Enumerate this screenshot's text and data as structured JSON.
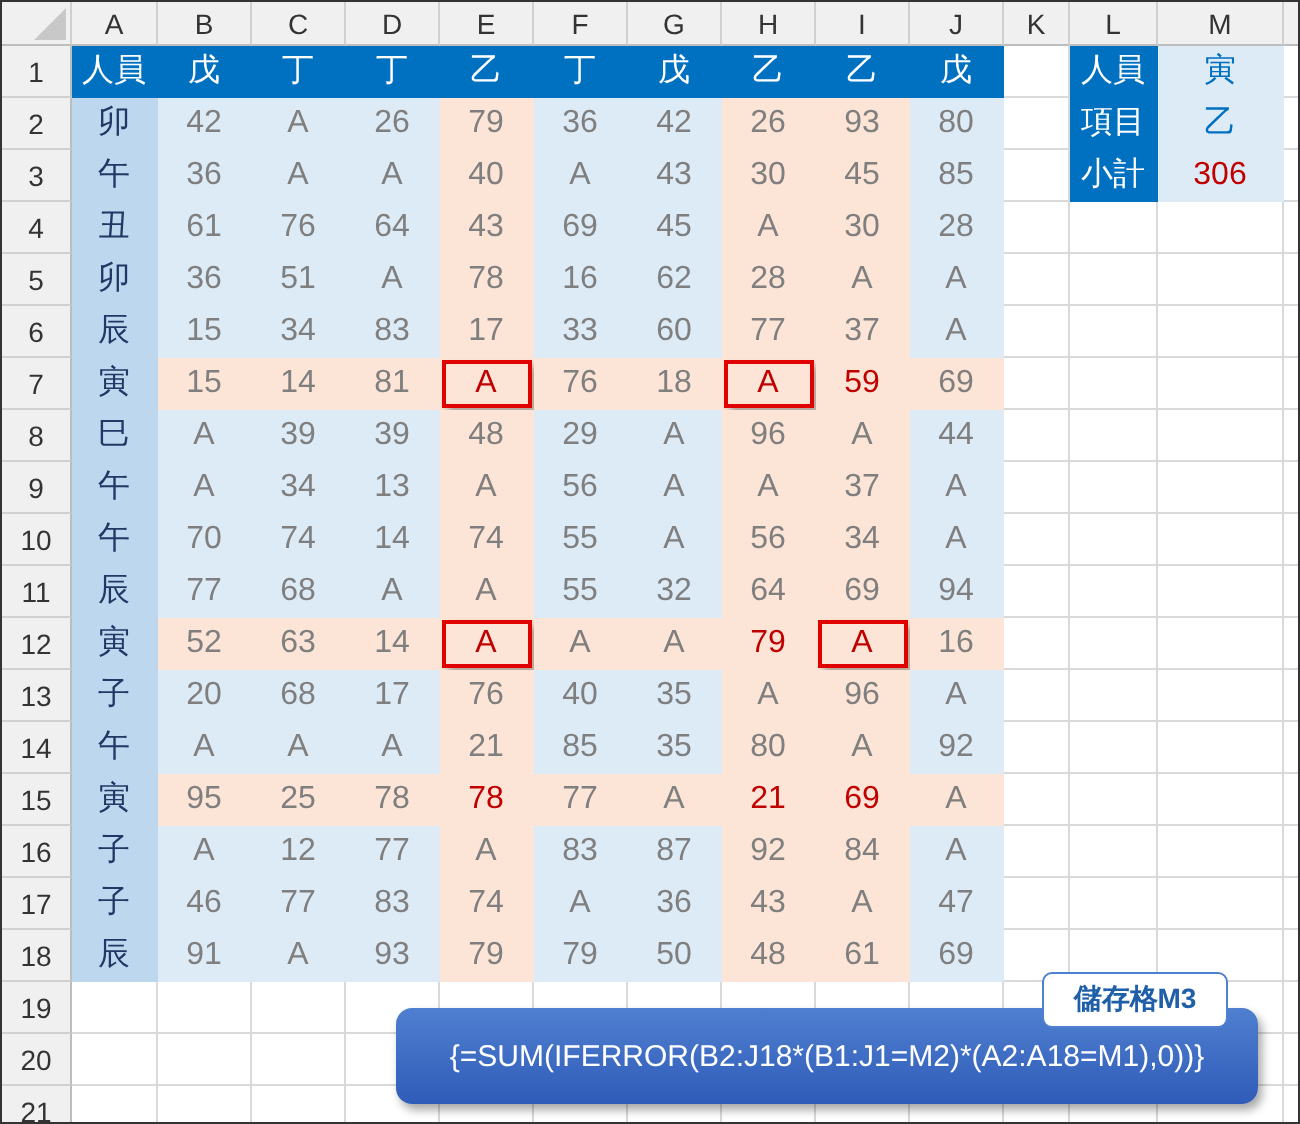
{
  "column_headers": [
    "A",
    "B",
    "C",
    "D",
    "E",
    "F",
    "G",
    "H",
    "I",
    "J",
    "K",
    "L",
    "M"
  ],
  "row_numbers": [
    "1",
    "2",
    "3",
    "4",
    "5",
    "6",
    "7",
    "8",
    "9",
    "10",
    "11",
    "12",
    "13",
    "14",
    "15",
    "16",
    "17",
    "18",
    "19",
    "20",
    "21"
  ],
  "table": {
    "corner": "人員",
    "columns": [
      {
        "label": "戊",
        "highlighted": false
      },
      {
        "label": "丁",
        "highlighted": false
      },
      {
        "label": "丁",
        "highlighted": false
      },
      {
        "label": "乙",
        "highlighted": true
      },
      {
        "label": "丁",
        "highlighted": false
      },
      {
        "label": "戊",
        "highlighted": false
      },
      {
        "label": "乙",
        "highlighted": true
      },
      {
        "label": "乙",
        "highlighted": true
      },
      {
        "label": "戊",
        "highlighted": false
      }
    ],
    "rows": [
      {
        "name": "卯",
        "highlighted": false,
        "cells": [
          {
            "text": "42",
            "boxed": false
          },
          {
            "text": "A",
            "boxed": false
          },
          {
            "text": "26",
            "boxed": false
          },
          {
            "text": "79",
            "boxed": false
          },
          {
            "text": "36",
            "boxed": false
          },
          {
            "text": "42",
            "boxed": false
          },
          {
            "text": "26",
            "boxed": false
          },
          {
            "text": "93",
            "boxed": false
          },
          {
            "text": "80",
            "boxed": false
          }
        ]
      },
      {
        "name": "午",
        "highlighted": false,
        "cells": [
          {
            "text": "36",
            "boxed": false
          },
          {
            "text": "A",
            "boxed": false
          },
          {
            "text": "A",
            "boxed": false
          },
          {
            "text": "40",
            "boxed": false
          },
          {
            "text": "A",
            "boxed": false
          },
          {
            "text": "43",
            "boxed": false
          },
          {
            "text": "30",
            "boxed": false
          },
          {
            "text": "45",
            "boxed": false
          },
          {
            "text": "85",
            "boxed": false
          }
        ]
      },
      {
        "name": "丑",
        "highlighted": false,
        "cells": [
          {
            "text": "61",
            "boxed": false
          },
          {
            "text": "76",
            "boxed": false
          },
          {
            "text": "64",
            "boxed": false
          },
          {
            "text": "43",
            "boxed": false
          },
          {
            "text": "69",
            "boxed": false
          },
          {
            "text": "45",
            "boxed": false
          },
          {
            "text": "A",
            "boxed": false
          },
          {
            "text": "30",
            "boxed": false
          },
          {
            "text": "28",
            "boxed": false
          }
        ]
      },
      {
        "name": "卯",
        "highlighted": false,
        "cells": [
          {
            "text": "36",
            "boxed": false
          },
          {
            "text": "51",
            "boxed": false
          },
          {
            "text": "A",
            "boxed": false
          },
          {
            "text": "78",
            "boxed": false
          },
          {
            "text": "16",
            "boxed": false
          },
          {
            "text": "62",
            "boxed": false
          },
          {
            "text": "28",
            "boxed": false
          },
          {
            "text": "A",
            "boxed": false
          },
          {
            "text": "A",
            "boxed": false
          }
        ]
      },
      {
        "name": "辰",
        "highlighted": false,
        "cells": [
          {
            "text": "15",
            "boxed": false
          },
          {
            "text": "34",
            "boxed": false
          },
          {
            "text": "83",
            "boxed": false
          },
          {
            "text": "17",
            "boxed": false
          },
          {
            "text": "33",
            "boxed": false
          },
          {
            "text": "60",
            "boxed": false
          },
          {
            "text": "77",
            "boxed": false
          },
          {
            "text": "37",
            "boxed": false
          },
          {
            "text": "A",
            "boxed": false
          }
        ]
      },
      {
        "name": "寅",
        "highlighted": true,
        "cells": [
          {
            "text": "15",
            "boxed": false
          },
          {
            "text": "14",
            "boxed": false
          },
          {
            "text": "81",
            "boxed": false
          },
          {
            "text": "A",
            "boxed": true
          },
          {
            "text": "76",
            "boxed": false
          },
          {
            "text": "18",
            "boxed": false
          },
          {
            "text": "A",
            "boxed": true
          },
          {
            "text": "59",
            "boxed": false
          },
          {
            "text": "69",
            "boxed": false
          }
        ]
      },
      {
        "name": "巳",
        "highlighted": false,
        "cells": [
          {
            "text": "A",
            "boxed": false
          },
          {
            "text": "39",
            "boxed": false
          },
          {
            "text": "39",
            "boxed": false
          },
          {
            "text": "48",
            "boxed": false
          },
          {
            "text": "29",
            "boxed": false
          },
          {
            "text": "A",
            "boxed": false
          },
          {
            "text": "96",
            "boxed": false
          },
          {
            "text": "A",
            "boxed": false
          },
          {
            "text": "44",
            "boxed": false
          }
        ]
      },
      {
        "name": "午",
        "highlighted": false,
        "cells": [
          {
            "text": "A",
            "boxed": false
          },
          {
            "text": "34",
            "boxed": false
          },
          {
            "text": "13",
            "boxed": false
          },
          {
            "text": "A",
            "boxed": false
          },
          {
            "text": "56",
            "boxed": false
          },
          {
            "text": "A",
            "boxed": false
          },
          {
            "text": "A",
            "boxed": false
          },
          {
            "text": "37",
            "boxed": false
          },
          {
            "text": "A",
            "boxed": false
          }
        ]
      },
      {
        "name": "午",
        "highlighted": false,
        "cells": [
          {
            "text": "70",
            "boxed": false
          },
          {
            "text": "74",
            "boxed": false
          },
          {
            "text": "14",
            "boxed": false
          },
          {
            "text": "74",
            "boxed": false
          },
          {
            "text": "55",
            "boxed": false
          },
          {
            "text": "A",
            "boxed": false
          },
          {
            "text": "56",
            "boxed": false
          },
          {
            "text": "34",
            "boxed": false
          },
          {
            "text": "A",
            "boxed": false
          }
        ]
      },
      {
        "name": "辰",
        "highlighted": false,
        "cells": [
          {
            "text": "77",
            "boxed": false
          },
          {
            "text": "68",
            "boxed": false
          },
          {
            "text": "A",
            "boxed": false
          },
          {
            "text": "A",
            "boxed": false
          },
          {
            "text": "55",
            "boxed": false
          },
          {
            "text": "32",
            "boxed": false
          },
          {
            "text": "64",
            "boxed": false
          },
          {
            "text": "69",
            "boxed": false
          },
          {
            "text": "94",
            "boxed": false
          }
        ]
      },
      {
        "name": "寅",
        "highlighted": true,
        "cells": [
          {
            "text": "52",
            "boxed": false
          },
          {
            "text": "63",
            "boxed": false
          },
          {
            "text": "14",
            "boxed": false
          },
          {
            "text": "A",
            "boxed": true
          },
          {
            "text": "A",
            "boxed": false
          },
          {
            "text": "A",
            "boxed": false
          },
          {
            "text": "79",
            "boxed": false
          },
          {
            "text": "A",
            "boxed": true
          },
          {
            "text": "16",
            "boxed": false
          }
        ]
      },
      {
        "name": "子",
        "highlighted": false,
        "cells": [
          {
            "text": "20",
            "boxed": false
          },
          {
            "text": "68",
            "boxed": false
          },
          {
            "text": "17",
            "boxed": false
          },
          {
            "text": "76",
            "boxed": false
          },
          {
            "text": "40",
            "boxed": false
          },
          {
            "text": "35",
            "boxed": false
          },
          {
            "text": "A",
            "boxed": false
          },
          {
            "text": "96",
            "boxed": false
          },
          {
            "text": "A",
            "boxed": false
          }
        ]
      },
      {
        "name": "午",
        "highlighted": false,
        "cells": [
          {
            "text": "A",
            "boxed": false
          },
          {
            "text": "A",
            "boxed": false
          },
          {
            "text": "A",
            "boxed": false
          },
          {
            "text": "21",
            "boxed": false
          },
          {
            "text": "85",
            "boxed": false
          },
          {
            "text": "35",
            "boxed": false
          },
          {
            "text": "80",
            "boxed": false
          },
          {
            "text": "A",
            "boxed": false
          },
          {
            "text": "92",
            "boxed": false
          }
        ]
      },
      {
        "name": "寅",
        "highlighted": true,
        "cells": [
          {
            "text": "95",
            "boxed": false
          },
          {
            "text": "25",
            "boxed": false
          },
          {
            "text": "78",
            "boxed": false
          },
          {
            "text": "78",
            "boxed": false
          },
          {
            "text": "77",
            "boxed": false
          },
          {
            "text": "A",
            "boxed": false
          },
          {
            "text": "21",
            "boxed": false
          },
          {
            "text": "69",
            "boxed": false
          },
          {
            "text": "A",
            "boxed": false
          }
        ]
      },
      {
        "name": "子",
        "highlighted": false,
        "cells": [
          {
            "text": "A",
            "boxed": false
          },
          {
            "text": "12",
            "boxed": false
          },
          {
            "text": "77",
            "boxed": false
          },
          {
            "text": "A",
            "boxed": false
          },
          {
            "text": "83",
            "boxed": false
          },
          {
            "text": "87",
            "boxed": false
          },
          {
            "text": "92",
            "boxed": false
          },
          {
            "text": "84",
            "boxed": false
          },
          {
            "text": "A",
            "boxed": false
          }
        ]
      },
      {
        "name": "子",
        "highlighted": false,
        "cells": [
          {
            "text": "46",
            "boxed": false
          },
          {
            "text": "77",
            "boxed": false
          },
          {
            "text": "83",
            "boxed": false
          },
          {
            "text": "74",
            "boxed": false
          },
          {
            "text": "A",
            "boxed": false
          },
          {
            "text": "36",
            "boxed": false
          },
          {
            "text": "43",
            "boxed": false
          },
          {
            "text": "A",
            "boxed": false
          },
          {
            "text": "47",
            "boxed": false
          }
        ]
      },
      {
        "name": "辰",
        "highlighted": false,
        "cells": [
          {
            "text": "91",
            "boxed": false
          },
          {
            "text": "A",
            "boxed": false
          },
          {
            "text": "93",
            "boxed": false
          },
          {
            "text": "79",
            "boxed": false
          },
          {
            "text": "79",
            "boxed": false
          },
          {
            "text": "50",
            "boxed": false
          },
          {
            "text": "48",
            "boxed": false
          },
          {
            "text": "61",
            "boxed": false
          },
          {
            "text": "69",
            "boxed": false
          }
        ]
      }
    ]
  },
  "lookup": [
    {
      "label": "人員",
      "value": "寅",
      "highlighted": false
    },
    {
      "label": "項目",
      "value": "乙",
      "highlighted": false
    },
    {
      "label": "小計",
      "value": "306",
      "highlighted": true
    }
  ],
  "callout": {
    "tag": "儲存格M3",
    "formula": "{=SUM(IFERROR(B2:J18*(B1:J1=M2)*(A2:A18=M1),0))}"
  }
}
